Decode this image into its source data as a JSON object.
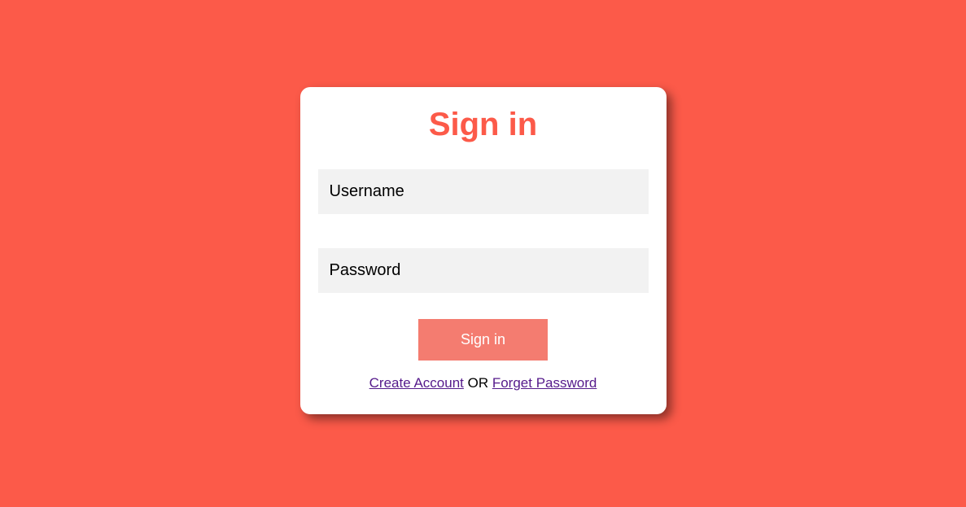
{
  "title": "Sign in",
  "form": {
    "username_placeholder": "Username",
    "password_placeholder": "Password",
    "submit_label": "Sign in"
  },
  "links": {
    "create_account": "Create Account",
    "separator": " OR ",
    "forget_password": "Forget Password"
  },
  "colors": {
    "background": "#fc5a49",
    "card": "#ffffff",
    "accent": "#fc5a49",
    "button": "#f47c70",
    "link": "#551A8B"
  }
}
